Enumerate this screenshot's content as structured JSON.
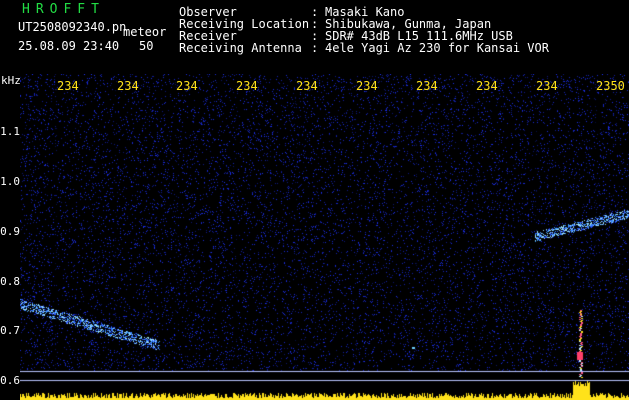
{
  "header": {
    "brand": "HROFFT",
    "filename": "UT2508092340.pn",
    "filename_suffix": "meteor",
    "datetime": "25.08.09 23:40",
    "count": "50"
  },
  "info": [
    {
      "key": "Observer",
      "sep": ":",
      "value": "Masaki Kano"
    },
    {
      "key": "Receiving Location",
      "sep": ":",
      "value": "Shibukawa, Gunma, Japan"
    },
    {
      "key": "Receiver",
      "sep": ":",
      "value": "SDR# 43dB L15 111.6MHz USB"
    },
    {
      "key": "Receiving Antenna",
      "sep": ":",
      "value": "4ele Yagi Az 230 for Kansai VOR"
    }
  ],
  "axis": {
    "unit": "kHz",
    "y_labels": [
      "1.1",
      "1.0",
      "0.9",
      "0.8",
      "0.7",
      "0.6"
    ],
    "x_labels": [
      "234",
      "234",
      "234",
      "234",
      "234",
      "234",
      "234",
      "234",
      "234",
      "2350"
    ]
  },
  "colors": {
    "background": "#000000",
    "noise": "#1a2cc8",
    "echo": "#6fd0ff",
    "tick": "#ffe21a",
    "brand": "#22dd44"
  }
}
